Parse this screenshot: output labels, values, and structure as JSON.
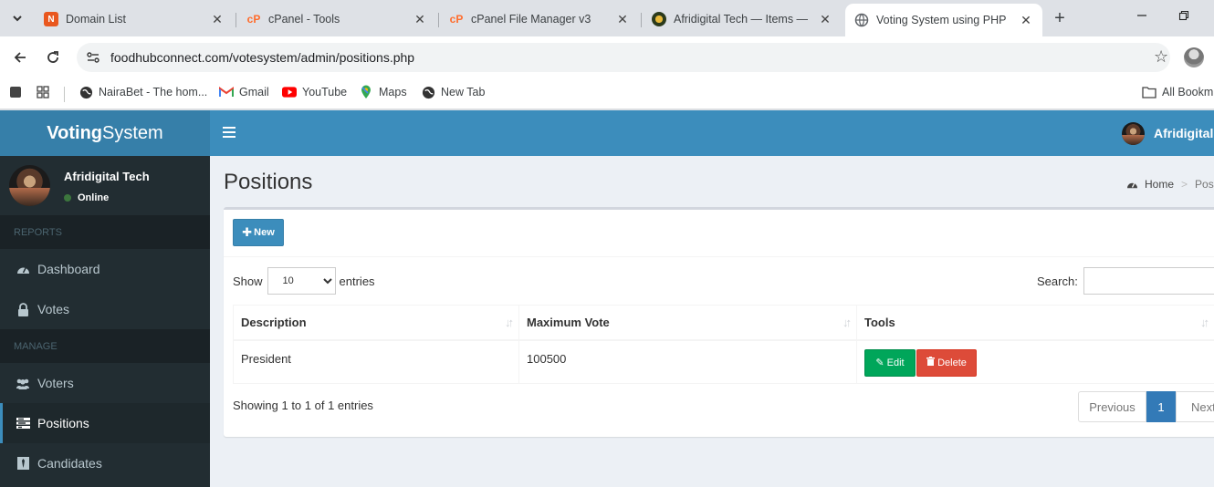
{
  "browser": {
    "tabs": [
      {
        "title": "Domain List",
        "icon": "namecheap-favicon"
      },
      {
        "title": "cPanel - Tools",
        "icon": "cpanel-favicon"
      },
      {
        "title": "cPanel File Manager v3",
        "icon": "cpanel-favicon"
      },
      {
        "title": "Afridigital Tech — Items — ",
        "icon": "site-favicon"
      },
      {
        "title": "Voting System using PHP",
        "icon": "globe-icon"
      }
    ],
    "url": "foodhubconnect.com/votesystem/admin/positions.php",
    "bookmarks": [
      {
        "label": "NairaBet - The hom..."
      },
      {
        "label": "Gmail"
      },
      {
        "label": "YouTube"
      },
      {
        "label": "Maps"
      },
      {
        "label": "New Tab"
      }
    ],
    "all_bookmarks": "All Bookm"
  },
  "app": {
    "logo_bold": "Voting",
    "logo_rest": "System",
    "user_name": "Afridigital Tech",
    "user_status": "Online",
    "top_user": "Afridigital T",
    "sidebar": {
      "header_reports": "REPORTS",
      "dashboard": "Dashboard",
      "votes": "Votes",
      "header_manage": "MANAGE",
      "voters": "Voters",
      "positions": "Positions",
      "candidates": "Candidates"
    },
    "page_title": "Positions",
    "breadcrumb_home": "Home",
    "breadcrumb_current": "Posit",
    "new_button": "New",
    "show_label": "Show",
    "entries_label": "entries",
    "page_length": "10",
    "search_label": "Search:",
    "columns": {
      "description": "Description",
      "maximum_vote": "Maximum Vote",
      "tools": "Tools"
    },
    "rows": [
      {
        "description": "President",
        "maximum_vote": "100500"
      }
    ],
    "edit_button": "Edit",
    "delete_button": "Delete",
    "info": "Showing 1 to 1 of 1 entries",
    "pagination": {
      "previous": "Previous",
      "current": "1",
      "next": "Next"
    }
  },
  "colors": {
    "topbar": "#3c8dbc",
    "logo_bg": "#367fa9",
    "sidebar": "#222d32",
    "success": "#00a65a",
    "danger": "#dd4b39"
  }
}
